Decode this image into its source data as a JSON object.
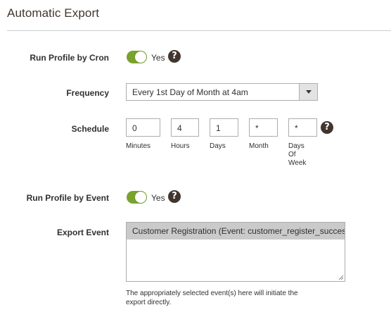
{
  "section": {
    "title": "Automatic Export"
  },
  "run_cron": {
    "label": "Run Profile by Cron",
    "toggle_text": "Yes",
    "enabled": true,
    "help_icon": "question-circle-icon"
  },
  "frequency": {
    "label": "Frequency",
    "selected": "Every 1st Day of Month at 4am"
  },
  "schedule": {
    "label": "Schedule",
    "fields": [
      {
        "value": "0",
        "caption": "Minutes"
      },
      {
        "value": "4",
        "caption": "Hours"
      },
      {
        "value": "1",
        "caption": "Days"
      },
      {
        "value": "*",
        "caption": "Month"
      },
      {
        "value": "*",
        "caption": "Days Of Week"
      }
    ]
  },
  "run_event": {
    "label": "Run Profile by Event",
    "toggle_text": "Yes",
    "enabled": true,
    "help_icon": "question-circle-icon"
  },
  "export_event": {
    "label": "Export Event",
    "options": [
      "Customer Registration (Event: customer_register_success)"
    ],
    "note": "The appropriately selected event(s) here will initiate the export directly."
  },
  "colors": {
    "toggle_on": "#79a22e",
    "help_bg": "#41362f",
    "selected_option": "#cacaca"
  }
}
